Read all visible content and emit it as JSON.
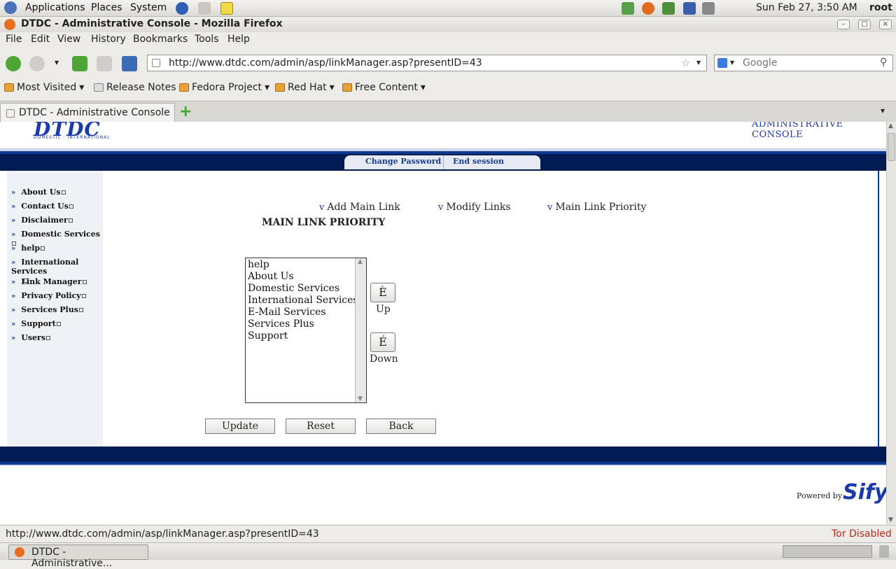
{
  "panel": {
    "applications": "Applications",
    "places": "Places",
    "system": "System",
    "clock": "Sun Feb 27,  3:50 AM",
    "user": "root"
  },
  "window": {
    "title": "DTDC - Administrative Console - Mozilla Firefox"
  },
  "menubar": {
    "items": [
      "File",
      "Edit",
      "View",
      "History",
      "Bookmarks",
      "Tools",
      "Help"
    ]
  },
  "navbar": {
    "url": "http://www.dtdc.com/admin/asp/linkManager.asp?presentID=43",
    "search_placeholder": "Google"
  },
  "bookmarks": {
    "items": [
      "Most Visited",
      "Release Notes",
      "Fedora Project",
      "Red Hat",
      "Free Content"
    ]
  },
  "tabs": {
    "active": "DTDC - Administrative Console"
  },
  "page": {
    "logo": "DTDC",
    "logo_sub": "DOMESTIC · INTERNATIONAL",
    "admin_title": "ADMINISTRATIVE CONSOLE",
    "top_links": [
      "Change Password",
      "End session"
    ],
    "sidebar": [
      "About Us",
      "Contact Us",
      "Disclaimer",
      "Domestic Services",
      "help",
      "International Services",
      "Link Manager",
      "Privacy Policy",
      "Services Plus",
      "Support",
      "Users"
    ],
    "subnav": [
      "Add Main Link",
      "Modify Links",
      "Main Link Priority"
    ],
    "subnav_bullet": "v",
    "heading": "MAIN LINK PRIORITY",
    "list_options": [
      "help",
      "About Us",
      "Domestic Services",
      "International Services",
      "E-Mail Services",
      "Services Plus",
      "Support"
    ],
    "up_glyph": "È",
    "up_label": "Up",
    "down_glyph": "É",
    "down_label": "Down",
    "buttons": [
      "Update",
      "Reset",
      "Back"
    ],
    "powered_by": "Powered by",
    "sify": "Sify"
  },
  "statusbar": {
    "url": "http://www.dtdc.com/admin/asp/linkManager.asp?presentID=43",
    "tor": "Tor Disabled"
  },
  "taskbar": {
    "window_button": "DTDC - Administrative..."
  }
}
